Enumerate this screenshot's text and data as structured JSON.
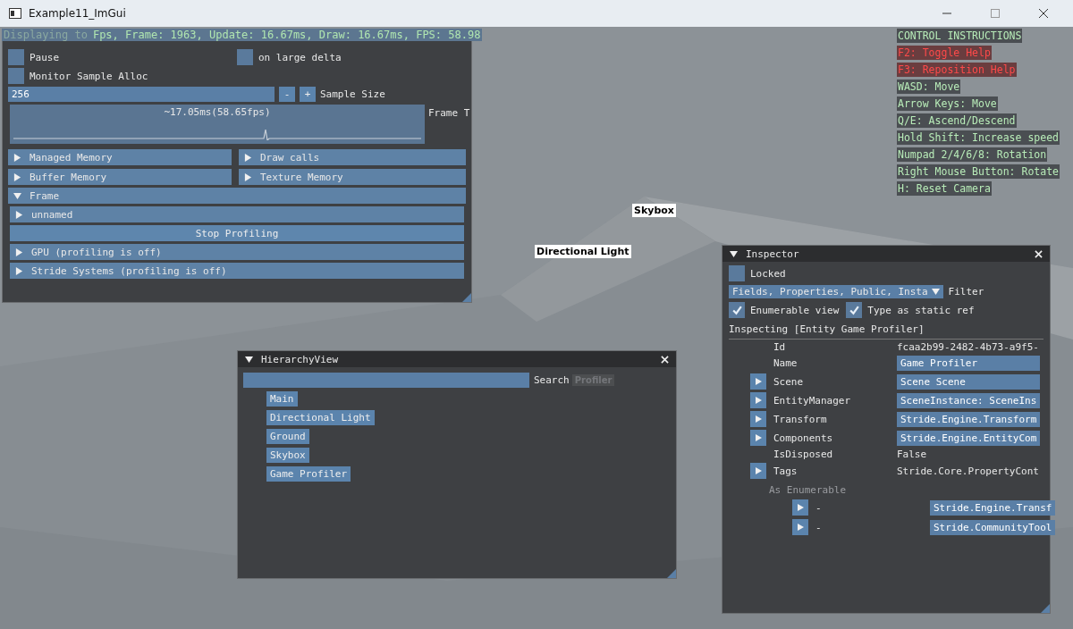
{
  "window": {
    "title": "Example11_ImGui"
  },
  "status_line": {
    "prefix": "Displaying to",
    "text": "Fps, Frame: 1963, Update: 16.67ms, Draw: 16.67ms, FPS: 58.98"
  },
  "help": [
    {
      "text": "CONTROL INSTRUCTIONS",
      "kind": "normal"
    },
    {
      "text": "F2: Toggle Help",
      "kind": "warning"
    },
    {
      "text": "F3: Reposition Help",
      "kind": "warning"
    },
    {
      "text": "WASD: Move",
      "kind": "normal"
    },
    {
      "text": "Arrow Keys: Move",
      "kind": "normal"
    },
    {
      "text": "Q/E: Ascend/Descend",
      "kind": "normal"
    },
    {
      "text": "Hold Shift: Increase speed",
      "kind": "normal"
    },
    {
      "text": "Numpad 2/4/6/8: Rotation",
      "kind": "normal"
    },
    {
      "text": "Right Mouse Button: Rotate",
      "kind": "normal"
    },
    {
      "text": "H: Reset Camera",
      "kind": "normal"
    }
  ],
  "scene_labels": [
    {
      "text": "Skybox"
    },
    {
      "text": "Directional Light"
    }
  ],
  "profiler": {
    "checkboxes": [
      {
        "label": "Pause",
        "checked": false
      },
      {
        "label": "on large delta",
        "checked": false
      },
      {
        "label": "Monitor Sample Alloc",
        "checked": false
      }
    ],
    "sample_size": {
      "value": "256",
      "minus": "-",
      "plus": "+",
      "label": "Sample Size"
    },
    "plot": {
      "overlay": "~17.05ms(58.65fps)",
      "label": "Frame T"
    },
    "memory_headers": [
      {
        "label": "Managed Memory",
        "expanded": false
      },
      {
        "label": "Draw calls",
        "expanded": false
      },
      {
        "label": "Buffer Memory",
        "expanded": false
      },
      {
        "label": "Texture Memory",
        "expanded": false
      }
    ],
    "frame": {
      "label": "Frame",
      "expanded": true,
      "children": [
        {
          "kind": "header",
          "label": "unnamed",
          "expanded": false
        },
        {
          "kind": "button",
          "label": "Stop Profiling"
        },
        {
          "kind": "header",
          "label": "GPU (profiling is off)",
          "expanded": false
        },
        {
          "kind": "header",
          "label": "Stride Systems (profiling is off)",
          "expanded": false
        }
      ]
    }
  },
  "hierarchy": {
    "title": "HierarchyView",
    "expanded": true,
    "search_button": "Search",
    "ghost_label": "Profiler",
    "items": [
      {
        "label": "Main"
      },
      {
        "label": "Directional Light"
      },
      {
        "label": "Ground"
      },
      {
        "label": "Skybox"
      },
      {
        "label": "Game Profiler"
      }
    ]
  },
  "inspector": {
    "title": "Inspector",
    "expanded": true,
    "locked": {
      "label": "Locked",
      "checked": false
    },
    "filter": {
      "value": "Fields, Properties, Public, Insta",
      "label": "Filter"
    },
    "options": [
      {
        "label": "Enumerable view",
        "checked": true
      },
      {
        "label": "Type as static ref",
        "checked": true
      }
    ],
    "inspecting": "Inspecting [Entity Game Profiler]",
    "properties": [
      {
        "name": "Id",
        "value": "fcaa2b99-2482-4b73-a9f5-",
        "kind": "text",
        "expandable": false
      },
      {
        "name": "Name",
        "value": "Game Profiler",
        "kind": "field",
        "expandable": false
      },
      {
        "name": "Scene",
        "value": "Scene Scene",
        "kind": "field",
        "expandable": true
      },
      {
        "name": "EntityManager",
        "value": "SceneInstance: SceneIns",
        "kind": "field",
        "expandable": true
      },
      {
        "name": "Transform",
        "value": "Stride.Engine.Transform",
        "kind": "field",
        "expandable": true
      },
      {
        "name": "Components",
        "value": "Stride.Engine.EntityCom",
        "kind": "field",
        "expandable": true
      },
      {
        "name": "IsDisposed",
        "value": "False",
        "kind": "text",
        "expandable": false
      },
      {
        "name": "Tags",
        "value": "Stride.Core.PropertyCont",
        "kind": "text",
        "expandable": true
      }
    ],
    "enumerable": {
      "label": "As Enumerable",
      "items": [
        {
          "name": "-",
          "value": "Stride.Engine.Transf"
        },
        {
          "name": "-",
          "value": "Stride.CommunityTool"
        }
      ]
    }
  }
}
